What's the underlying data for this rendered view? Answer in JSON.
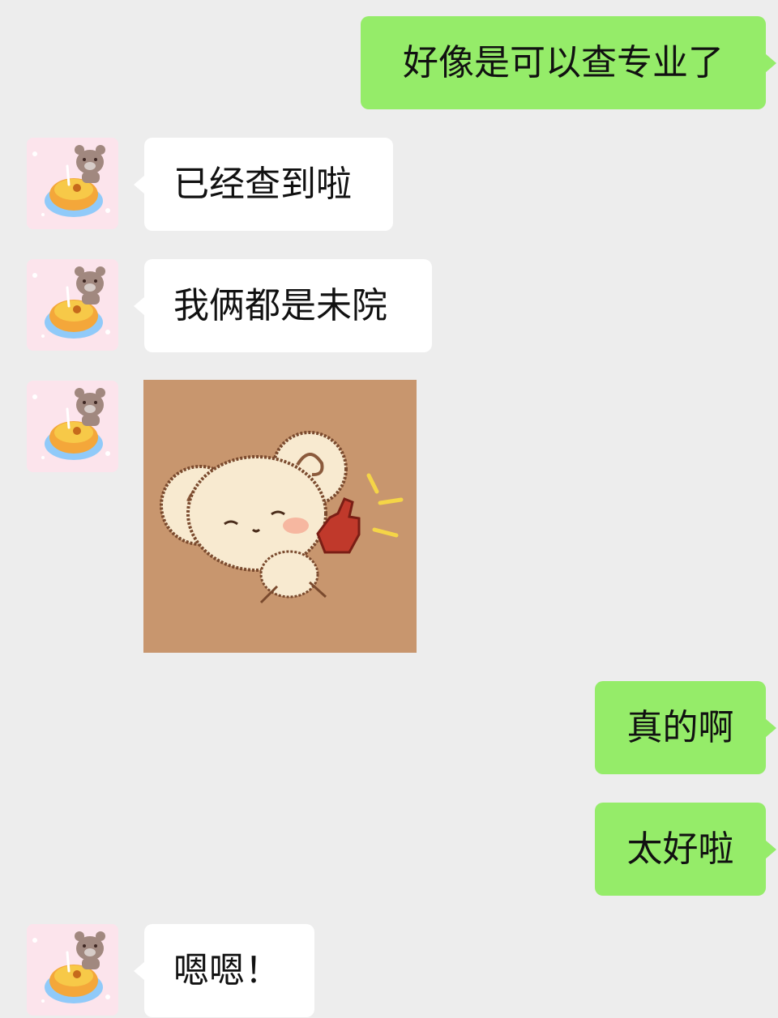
{
  "messages": [
    {
      "sender": "me",
      "text": "好像是可以查专业了"
    },
    {
      "sender": "other",
      "text": "已经查到啦"
    },
    {
      "sender": "other",
      "text": "我俩都是未院"
    },
    {
      "sender": "other",
      "sticker": "cream-bear-thumbs-up-sticker"
    },
    {
      "sender": "me",
      "text": "真的啊"
    },
    {
      "sender": "me",
      "text": "太好啦"
    },
    {
      "sender": "other",
      "text": "嗯嗯！"
    }
  ],
  "avatar": {
    "icon": "bear-on-egg-tart-avatar-icon"
  },
  "colors": {
    "background": "#ededed",
    "my_bubble": "#95ec69",
    "their_bubble": "#ffffff",
    "sticker_bg": "#c8966e"
  }
}
